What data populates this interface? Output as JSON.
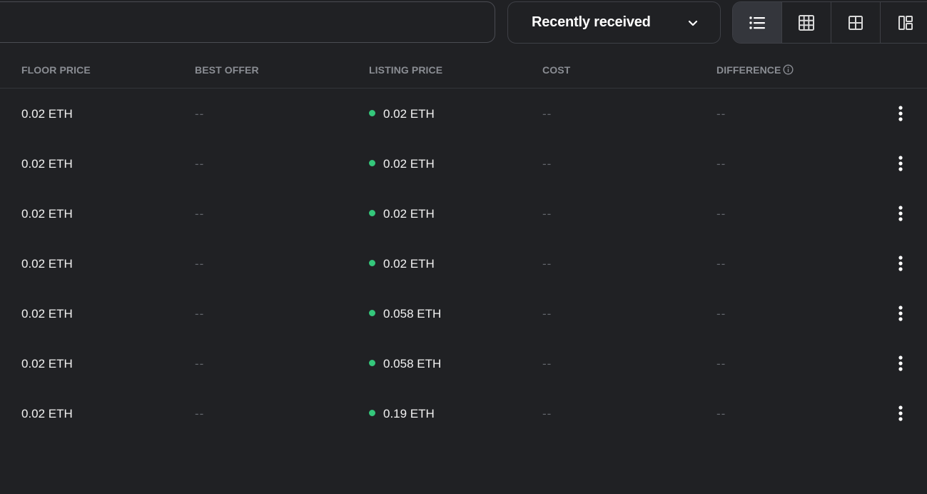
{
  "toolbar": {
    "search_value": "",
    "sort_label": "Recently received",
    "views": [
      {
        "name": "list-view",
        "active": true
      },
      {
        "name": "large-grid-view",
        "active": false
      },
      {
        "name": "small-grid-view",
        "active": false
      },
      {
        "name": "mosaic-view",
        "active": false
      }
    ]
  },
  "table": {
    "columns": {
      "floor_price": "FLOOR PRICE",
      "best_offer": "BEST OFFER",
      "listing_price": "LISTING PRICE",
      "cost": "COST",
      "difference": "DIFFERENCE"
    },
    "rows": [
      {
        "floor_price": "0.02 ETH",
        "best_offer": "--",
        "listing_price": "0.02 ETH",
        "cost": "--",
        "difference": "--"
      },
      {
        "floor_price": "0.02 ETH",
        "best_offer": "--",
        "listing_price": "0.02 ETH",
        "cost": "--",
        "difference": "--"
      },
      {
        "floor_price": "0.02 ETH",
        "best_offer": "--",
        "listing_price": "0.02 ETH",
        "cost": "--",
        "difference": "--"
      },
      {
        "floor_price": "0.02 ETH",
        "best_offer": "--",
        "listing_price": "0.02 ETH",
        "cost": "--",
        "difference": "--"
      },
      {
        "floor_price": "0.02 ETH",
        "best_offer": "--",
        "listing_price": "0.058 ETH",
        "cost": "--",
        "difference": "--"
      },
      {
        "floor_price": "0.02 ETH",
        "best_offer": "--",
        "listing_price": "0.058 ETH",
        "cost": "--",
        "difference": "--"
      },
      {
        "floor_price": "0.02 ETH",
        "best_offer": "--",
        "listing_price": "0.19 ETH",
        "cost": "--",
        "difference": "--"
      }
    ]
  },
  "colors": {
    "background": "#202124",
    "listed_dot": "#34c77b",
    "header_text": "#8a8d93",
    "muted_text": "#62656b"
  }
}
